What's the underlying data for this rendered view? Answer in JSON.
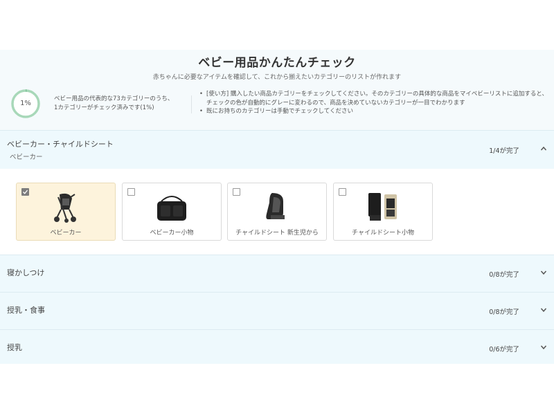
{
  "header": {
    "title": "ベビー用品かんたんチェック",
    "subtitle": "赤ちゃんに必要なアイテムを確認して、これから揃えたいカテゴリーのリストが作れます",
    "progress_percent": 1,
    "progress_label": "1%",
    "summary_line1": "ベビー用品の代表的な73カテゴリーのうち、",
    "summary_line2": "1カテゴリーがチェック済みです(1%)",
    "usage": [
      "[使い方] 購入したい商品カテゴリーをチェックしてください。そのカテゴリーの具体的な商品をマイベビーリストに追加すると、チェックの色が自動的にグレーに変わるので、商品を決めていないカテゴリーが一目でわかります",
      "既にお持ちのカテゴリーは手動でチェックしてください"
    ]
  },
  "sections": [
    {
      "name": "ベビーカー・チャイルドシート",
      "sub": "ベビーカー",
      "count": "1/4が完了",
      "expanded": true,
      "items": [
        {
          "label": "ベビーカー",
          "checked": true,
          "icon": "stroller-icon"
        },
        {
          "label": "ベビーカー小物",
          "checked": false,
          "icon": "stroller-bag-icon"
        },
        {
          "label": "チャイルドシート 新生児から",
          "checked": false,
          "icon": "car-seat-icon"
        },
        {
          "label": "チャイルドシート小物",
          "checked": false,
          "icon": "seat-protector-icon"
        }
      ]
    },
    {
      "name": "寝かしつけ",
      "count": "0/8が完了",
      "expanded": false
    },
    {
      "name": "授乳・食事",
      "count": "0/8が完了",
      "expanded": false
    },
    {
      "name": "授乳",
      "count": "0/6が完了",
      "expanded": false
    }
  ],
  "colors": {
    "accent_ring": "#a8d8b9",
    "checked_card_bg": "#fdf3dc",
    "section_bg": "#eef9fd"
  }
}
